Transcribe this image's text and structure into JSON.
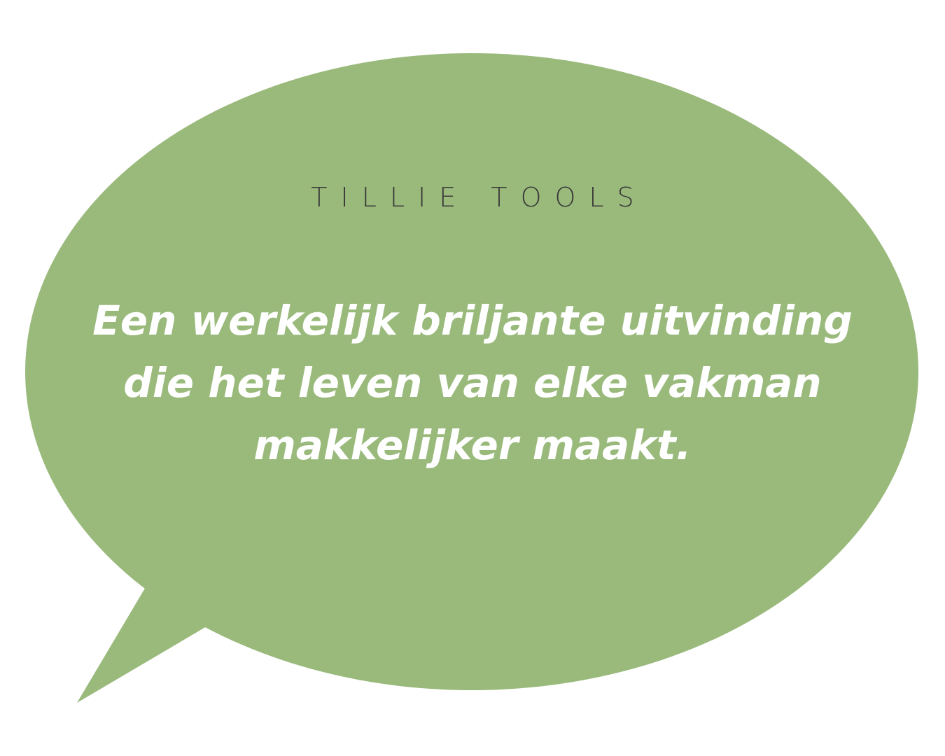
{
  "colors": {
    "bubble": "#9aba7c",
    "background": "#ffffff",
    "brand_text": "#3a3a38",
    "quote_text": "#ffffff"
  },
  "brand": {
    "name": "TILLIE TOOLS"
  },
  "quote": {
    "lines": [
      "Een werkelijk briljante uitvinding",
      "die het leven van elke vakman",
      "makkelijker maakt."
    ]
  }
}
